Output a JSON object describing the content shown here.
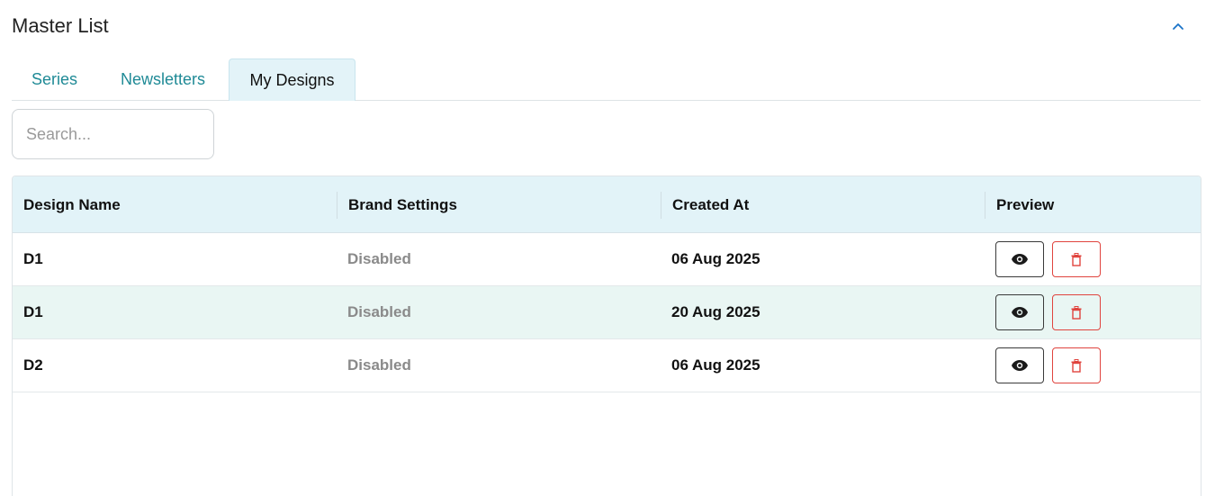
{
  "header": {
    "title": "Master List",
    "collapse_icon": "chevron-up-icon",
    "accent": "#1a73c8"
  },
  "tabs": [
    {
      "label": "Series",
      "active": false
    },
    {
      "label": "Newsletters",
      "active": false
    },
    {
      "label": "My Designs",
      "active": true
    }
  ],
  "search": {
    "placeholder": "Search...",
    "value": ""
  },
  "table": {
    "columns": [
      "Design Name",
      "Brand Settings",
      "Created At",
      "Preview"
    ],
    "rows": [
      {
        "name": "D1",
        "brand": "Disabled",
        "created": "06 Aug 2025"
      },
      {
        "name": "D1",
        "brand": "Disabled",
        "created": "20 Aug 2025"
      },
      {
        "name": "D2",
        "brand": "Disabled",
        "created": "06 Aug 2025"
      }
    ],
    "actions": {
      "preview_icon": "eye-icon",
      "delete_icon": "trash-icon"
    }
  },
  "colors": {
    "tab_text": "#1f8a96",
    "header_bg": "#e2f3f8",
    "row_alt_bg": "#e9f6f3",
    "delete": "#e0443e"
  }
}
